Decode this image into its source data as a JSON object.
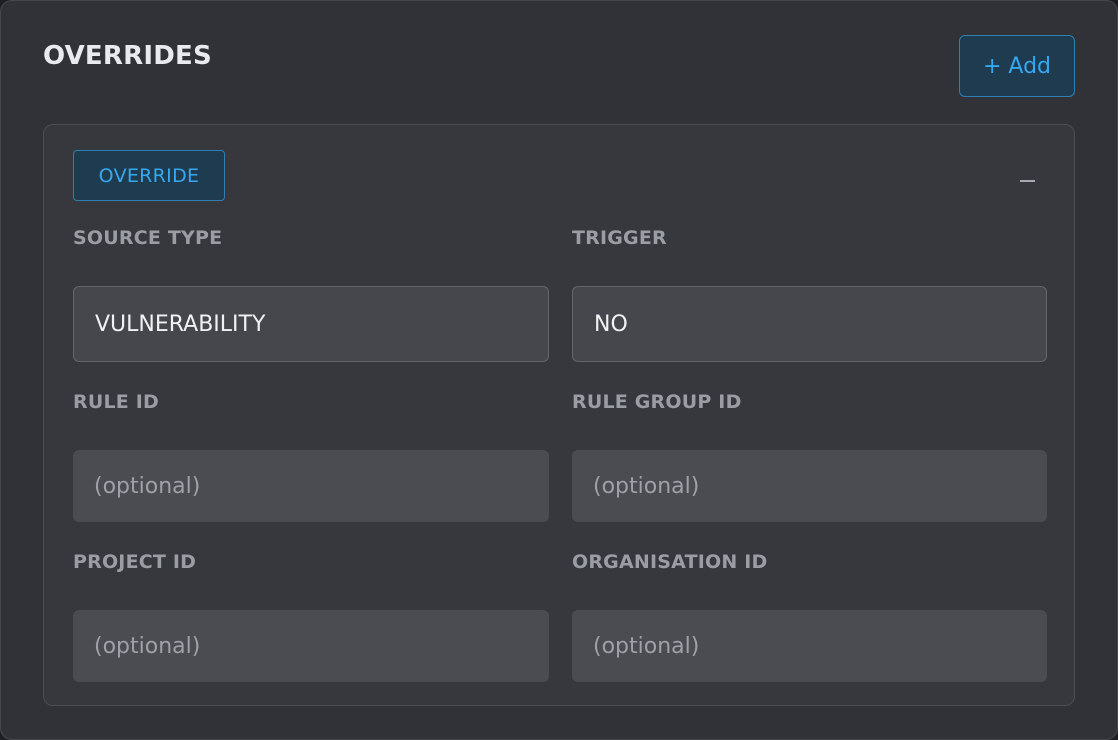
{
  "section": {
    "title": "OVERRIDES",
    "add_button": "+ Add"
  },
  "override": {
    "badge": "OVERRIDE",
    "fields": {
      "source_type": {
        "label": "SOURCE TYPE",
        "value": "VULNERABILITY"
      },
      "trigger": {
        "label": "TRIGGER",
        "value": "NO"
      },
      "rule_id": {
        "label": "RULE ID",
        "placeholder": "(optional)"
      },
      "rule_group_id": {
        "label": "RULE GROUP ID",
        "placeholder": "(optional)"
      },
      "project_id": {
        "label": "PROJECT ID",
        "placeholder": "(optional)"
      },
      "organisation_id": {
        "label": "ORGANISATION ID",
        "placeholder": "(optional)"
      }
    }
  },
  "colors": {
    "accent": "#35a8f0",
    "panel_bg": "#303237",
    "card_bg": "#36383d"
  },
  "icons": {
    "collapse": "minus-icon"
  }
}
